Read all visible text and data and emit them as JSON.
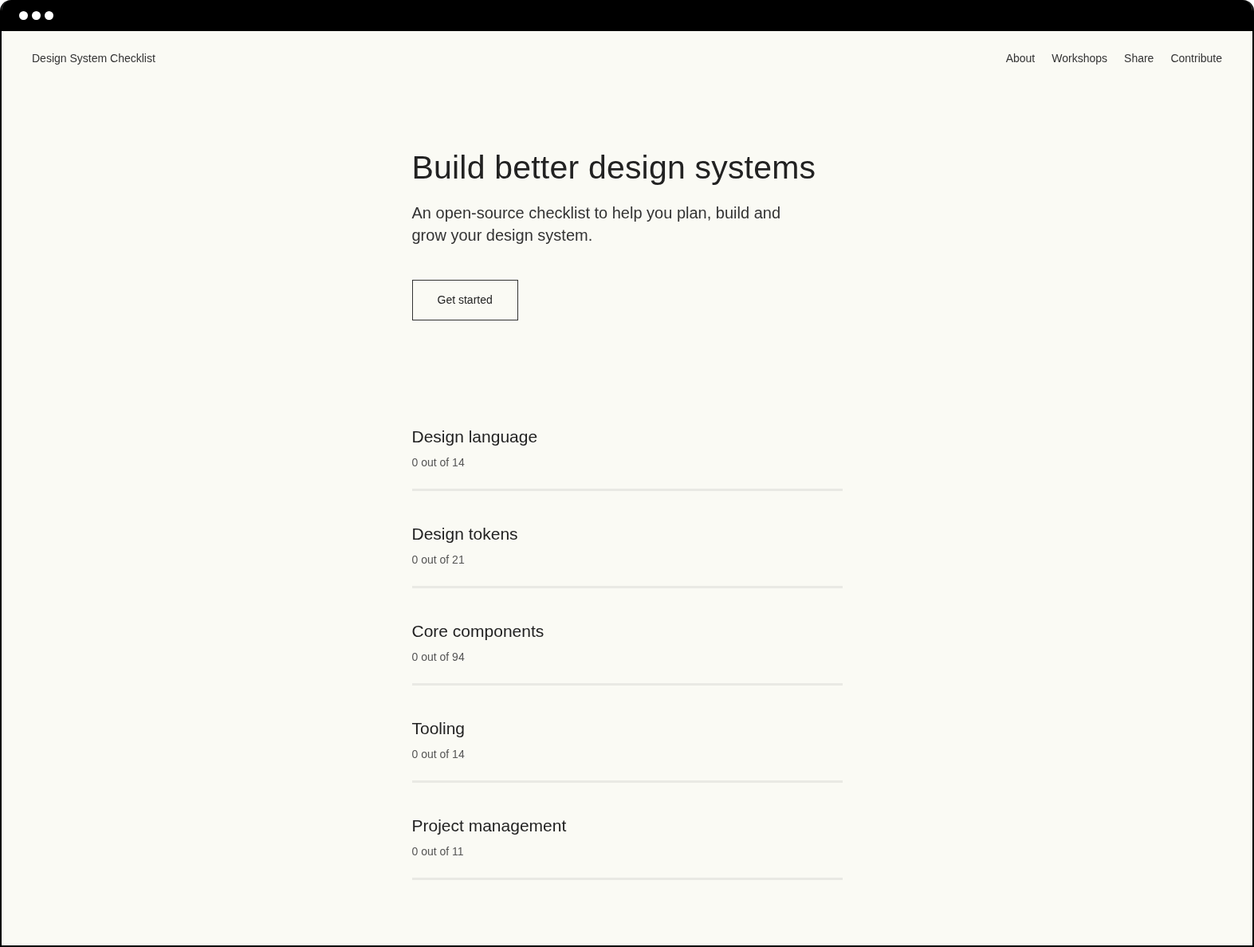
{
  "site": {
    "title": "Design System Checklist"
  },
  "nav": [
    {
      "label": "About"
    },
    {
      "label": "Workshops"
    },
    {
      "label": "Share"
    },
    {
      "label": "Contribute"
    }
  ],
  "hero": {
    "heading": "Build better design systems",
    "subtitle": "An open-source checklist to help you plan, build and grow your design system.",
    "button": "Get started"
  },
  "sections": [
    {
      "title": "Design language",
      "progress": "0 out of 14",
      "level": 0
    },
    {
      "title": "Design tokens",
      "progress": "0 out of 21",
      "level": 0
    },
    {
      "title": "Core components",
      "progress": "0 out of 94",
      "level": 0
    },
    {
      "title": "Tooling",
      "progress": "0 out of 14",
      "level": 0
    },
    {
      "title": "Project management",
      "progress": "0 out of 11",
      "level": 0
    }
  ]
}
